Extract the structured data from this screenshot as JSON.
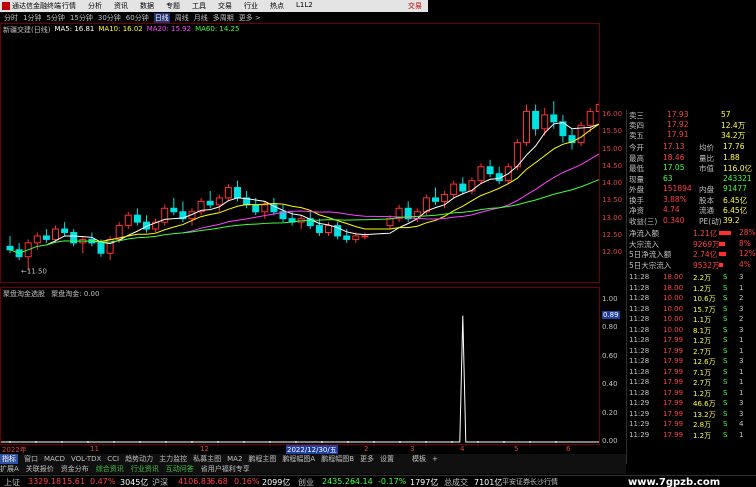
{
  "titlebar": {
    "app_title": "通达信金融终端",
    "menu": [
      "行情",
      "分析",
      "资讯",
      "数据",
      "专题",
      "工具",
      "交易",
      "行业",
      "热点",
      "L1L2"
    ],
    "trade_label": "交易"
  },
  "period_tabs": [
    {
      "label": "分时",
      "active": false
    },
    {
      "label": "1分钟",
      "active": false
    },
    {
      "label": "5分钟",
      "active": false
    },
    {
      "label": "15分钟",
      "active": false
    },
    {
      "label": "30分钟",
      "active": false
    },
    {
      "label": "60分钟",
      "active": false
    },
    {
      "label": "日线",
      "active": true
    },
    {
      "label": "周线",
      "active": false
    },
    {
      "label": "月线",
      "active": false
    },
    {
      "label": "多周期",
      "active": false
    },
    {
      "label": "更多 >",
      "active": false
    }
  ],
  "legend": {
    "stock": "新疆交建(日线)",
    "items": [
      {
        "label": "MA5: 16.81",
        "color": "#ffffff"
      },
      {
        "label": "MA10: 16.02",
        "color": "#ffff00"
      },
      {
        "label": "MA20: 15.92",
        "color": "#ff40ff"
      },
      {
        "label": "MA60: 14.25",
        "color": "#40ff40"
      }
    ]
  },
  "colors": {
    "up": "#ff3030",
    "down": "#00e0e0",
    "ma5": "#ffffff",
    "ma10": "#ffff00",
    "ma20": "#ff40ff",
    "ma60": "#40ff40",
    "accent": "#3050a0",
    "brand": "#c00000"
  },
  "main_yaxis": [
    "16.00",
    "15.50",
    "15.00",
    "14.50",
    "14.00",
    "13.50",
    "13.00",
    "12.50",
    "12.00"
  ],
  "main_annotations": {
    "low_price": "11.50"
  },
  "price_scale": {
    "min": 11.4,
    "max": 16.2
  },
  "bars": [
    [
      12.2,
      12.5,
      12.0,
      12.1
    ],
    [
      12.1,
      12.3,
      11.8,
      11.9
    ],
    [
      11.9,
      12.4,
      11.5,
      12.3
    ],
    [
      12.3,
      12.6,
      12.1,
      12.5
    ],
    [
      12.5,
      12.7,
      12.3,
      12.4
    ],
    [
      12.4,
      12.8,
      12.3,
      12.7
    ],
    [
      12.7,
      12.9,
      12.5,
      12.6
    ],
    [
      12.6,
      12.7,
      12.2,
      12.3
    ],
    [
      12.3,
      12.5,
      12.0,
      12.4
    ],
    [
      12.4,
      12.6,
      12.2,
      12.3
    ],
    [
      12.3,
      12.4,
      11.9,
      12.0
    ],
    [
      12.0,
      12.5,
      11.8,
      12.4
    ],
    [
      12.4,
      12.9,
      12.3,
      12.8
    ],
    [
      12.8,
      13.2,
      12.7,
      13.1
    ],
    [
      13.1,
      13.3,
      12.8,
      12.9
    ],
    [
      12.9,
      13.1,
      12.6,
      12.7
    ],
    [
      12.7,
      13.0,
      12.6,
      12.9
    ],
    [
      12.9,
      13.4,
      12.8,
      13.3
    ],
    [
      13.3,
      13.6,
      13.1,
      13.2
    ],
    [
      13.2,
      13.5,
      12.9,
      13.0
    ],
    [
      13.0,
      13.3,
      12.8,
      13.2
    ],
    [
      13.2,
      13.6,
      13.1,
      13.5
    ],
    [
      13.5,
      13.8,
      13.3,
      13.4
    ],
    [
      13.4,
      13.7,
      13.2,
      13.6
    ],
    [
      13.6,
      14.0,
      13.5,
      13.9
    ],
    [
      13.9,
      14.1,
      13.5,
      13.6
    ],
    [
      13.6,
      13.8,
      13.3,
      13.4
    ],
    [
      13.4,
      13.6,
      13.1,
      13.2
    ],
    [
      13.2,
      13.5,
      13.0,
      13.4
    ],
    [
      13.4,
      13.6,
      13.1,
      13.2
    ],
    [
      13.2,
      13.4,
      12.9,
      13.0
    ],
    [
      13.0,
      13.2,
      12.8,
      12.9
    ],
    [
      12.9,
      13.1,
      12.7,
      13.0
    ],
    [
      13.0,
      13.2,
      12.7,
      12.8
    ],
    [
      12.8,
      13.0,
      12.5,
      12.6
    ],
    [
      12.6,
      12.9,
      12.5,
      12.8
    ],
    [
      12.8,
      12.9,
      12.4,
      12.5
    ],
    [
      12.5,
      12.7,
      12.3,
      12.4
    ],
    [
      12.4,
      12.6,
      12.3,
      12.5
    ],
    [
      12.5,
      12.6,
      12.4,
      12.5
    ],
    [
      12.8,
      13.1,
      12.7,
      13.0
    ],
    [
      13.0,
      13.4,
      12.9,
      13.3
    ],
    [
      13.3,
      13.5,
      12.9,
      13.0
    ],
    [
      13.0,
      13.3,
      12.9,
      13.2
    ],
    [
      13.2,
      13.7,
      13.1,
      13.6
    ],
    [
      13.6,
      13.9,
      13.4,
      13.5
    ],
    [
      13.5,
      13.8,
      13.3,
      13.7
    ],
    [
      13.7,
      14.1,
      13.6,
      14.0
    ],
    [
      14.0,
      14.2,
      13.7,
      13.8
    ],
    [
      13.8,
      14.2,
      13.7,
      14.1
    ],
    [
      14.1,
      14.6,
      14.0,
      14.5
    ],
    [
      14.5,
      14.7,
      14.2,
      14.3
    ],
    [
      14.3,
      14.5,
      14.0,
      14.1
    ],
    [
      14.1,
      14.6,
      14.0,
      14.5
    ],
    [
      14.5,
      15.3,
      14.4,
      15.2
    ],
    [
      15.2,
      16.3,
      15.1,
      16.1
    ],
    [
      16.1,
      16.3,
      15.4,
      15.6
    ],
    [
      15.6,
      16.2,
      15.4,
      16.0
    ],
    [
      16.0,
      16.4,
      15.6,
      15.8
    ],
    [
      15.8,
      16.0,
      15.2,
      15.4
    ],
    [
      15.4,
      15.6,
      15.0,
      15.2
    ],
    [
      15.2,
      15.8,
      15.1,
      15.7
    ],
    [
      15.7,
      16.2,
      15.5,
      16.1
    ],
    [
      16.1,
      16.4,
      15.8,
      16.3
    ]
  ],
  "subchart": {
    "title": "聚盘淘金选股",
    "indicator": "聚盘淘金: 0.00",
    "yaxis": [
      "1.00",
      "0.89",
      "0.80",
      "0.60",
      "0.40",
      "0.20",
      "0.00"
    ],
    "peak_value": "0.89",
    "peak_index": 48,
    "series_max": 1.0
  },
  "date_axis": [
    "2022年",
    "11",
    "12",
    "2022/12/30/五",
    "2",
    "3",
    "4",
    "5",
    "6"
  ],
  "indicator_tabs": [
    "指标",
    "窗口",
    "MACD",
    "VOL-TDX",
    "CCI",
    "趋势动力",
    "主力监控",
    "私募主图",
    "MA2",
    "鹏程主图",
    "鹏程幅图A",
    "鹏程幅图B",
    "更多",
    "设置"
  ],
  "indicator_tabs_right": [
    "模板",
    "+"
  ],
  "nav2": [
    "扩展A",
    "关联报价",
    "资金分布",
    "综合资讯",
    "行业资讯",
    "互动问答",
    "省用户福利专享"
  ],
  "nav2_accent": [
    "综合资讯",
    "行业资讯",
    "互动问答"
  ],
  "quote_top": [
    {
      "label": "卖三",
      "price": "17.93",
      "vol": "57"
    },
    {
      "label": "卖四",
      "price": "17.92",
      "vol": "12.4万"
    },
    {
      "label": "卖五",
      "price": "17.91",
      "vol": "34.2万"
    }
  ],
  "quote_stats": [
    {
      "l1": "今开",
      "v1": "17.13",
      "l2": "均价",
      "v2": "17.76"
    },
    {
      "l1": "最高",
      "v1": "18.46",
      "l2": "量比",
      "v2": "1.88"
    },
    {
      "l1": "最低",
      "v1": "17.05",
      "l2": "市值",
      "v2": "116.0亿"
    },
    {
      "l1": "现量",
      "v1": "63",
      "l2": "",
      "v2": "243321"
    },
    {
      "l1": "外盘",
      "v1": "151894",
      "l2": "内盘",
      "v2": "91477"
    },
    {
      "l1": "换手",
      "v1": "3.88%",
      "l2": "股本",
      "v2": "6.45亿"
    },
    {
      "l1": "净资",
      "v1": "4.74",
      "l2": "流通",
      "v2": "6.45亿"
    },
    {
      "l1": "收益(三)",
      "v1": "0.340",
      "l2": "PE(动)",
      "v2": "39.2"
    }
  ],
  "flows": [
    {
      "label": "净流入额",
      "value": "1.21亿",
      "pct": "28%"
    },
    {
      "label": "大宗流入",
      "value": "9269万",
      "pct": "8%"
    },
    {
      "label": "5日净流入额",
      "value": "2.74亿",
      "pct": "12%"
    },
    {
      "label": "5日大宗流入",
      "value": "9532万",
      "pct": "4%"
    }
  ],
  "ticks": [
    {
      "time": "11:28",
      "price": "18.00",
      "vol": "2.2万",
      "side": "S",
      "n": "3"
    },
    {
      "time": "11:28",
      "price": "18.00",
      "vol": "1.2万",
      "side": "S",
      "n": "1"
    },
    {
      "time": "11:28",
      "price": "10.00",
      "vol": "10.6万",
      "side": "S",
      "n": "2"
    },
    {
      "time": "11:28",
      "price": "10.00",
      "vol": "15.7万",
      "side": "S",
      "n": "3"
    },
    {
      "time": "11:28",
      "price": "10.00",
      "vol": "1.1万",
      "side": "S",
      "n": "2"
    },
    {
      "time": "11:28",
      "price": "10.00",
      "vol": "8.1万",
      "side": "S",
      "n": "3"
    },
    {
      "time": "11:28",
      "price": "17.99",
      "vol": "1.2万",
      "side": "S",
      "n": "1"
    },
    {
      "time": "11:28",
      "price": "17.99",
      "vol": "2.7万",
      "side": "S",
      "n": "1"
    },
    {
      "time": "11:28",
      "price": "17.99",
      "vol": "12.6万",
      "side": "S",
      "n": "3"
    },
    {
      "time": "11:28",
      "price": "17.99",
      "vol": "7.1万",
      "side": "S",
      "n": "1"
    },
    {
      "time": "11:28",
      "price": "17.99",
      "vol": "2.7万",
      "side": "S",
      "n": "1"
    },
    {
      "time": "11:28",
      "price": "17.99",
      "vol": "1.2万",
      "side": "S",
      "n": "1"
    },
    {
      "time": "11:29",
      "price": "17.99",
      "vol": "46.6万",
      "side": "S",
      "n": "3"
    },
    {
      "time": "11:29",
      "price": "17.99",
      "vol": "13.2万",
      "side": "S",
      "n": "3"
    },
    {
      "time": "11:29",
      "price": "17.99",
      "vol": "2.8万",
      "side": "S",
      "n": "4"
    },
    {
      "time": "11:29",
      "price": "17.99",
      "vol": "1.2万",
      "side": "S",
      "n": "1"
    }
  ],
  "statusbar": {
    "items": [
      {
        "text": "上证",
        "color": "#c0c0c0"
      },
      {
        "text": "3329.18",
        "color": "#ff4040"
      },
      {
        "text": "15.61",
        "color": "#ff4040"
      },
      {
        "text": "0.47%",
        "color": "#ff4040"
      },
      {
        "text": "3045亿",
        "color": "#ffffff"
      },
      {
        "text": "沪深",
        "color": "#c0c0c0"
      },
      {
        "text": "4106.83",
        "color": "#ff4040"
      },
      {
        "text": "6.68",
        "color": "#ff4040"
      },
      {
        "text": "0.16%",
        "color": "#ff4040"
      },
      {
        "text": "2099亿",
        "color": "#ffffff"
      },
      {
        "text": "创业",
        "color": "#c0c0c0"
      },
      {
        "text": "2435.26",
        "color": "#40ff40"
      },
      {
        "text": "-4.14",
        "color": "#40ff40"
      },
      {
        "text": "-0.17%",
        "color": "#40ff40"
      },
      {
        "text": "1797亿",
        "color": "#ffffff"
      },
      {
        "text": "总成交",
        "color": "#c0c0c0"
      },
      {
        "text": "7101亿",
        "color": "#ffffff"
      },
      {
        "text": "平安证券长沙行情",
        "color": "#c0c0c0"
      }
    ]
  },
  "watermark": "www.7gpzb.com"
}
